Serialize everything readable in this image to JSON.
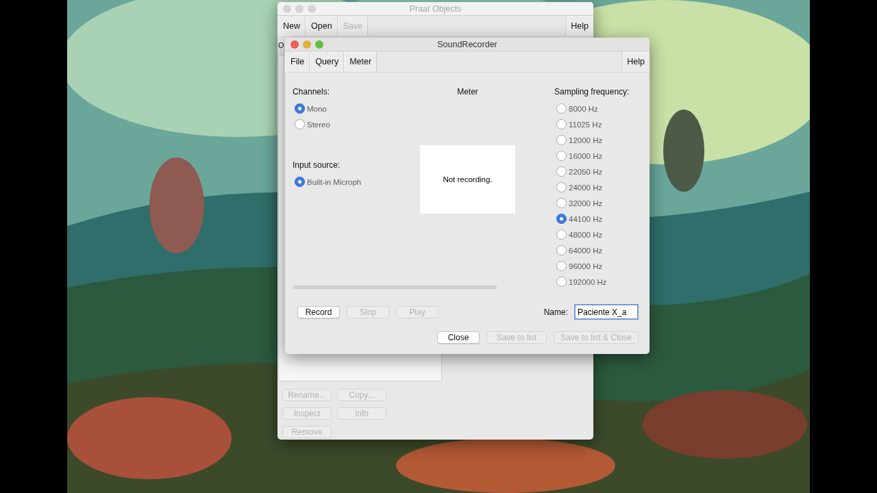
{
  "objects_window": {
    "title": "Praat Objects",
    "menus": [
      {
        "label": "New",
        "disabled": false
      },
      {
        "label": "Open",
        "disabled": false
      },
      {
        "label": "Save",
        "disabled": true
      }
    ],
    "help_menu": "Help",
    "list_label": "O",
    "buttons": [
      {
        "label": "Rename...",
        "disabled": true
      },
      {
        "label": "Copy...",
        "disabled": true
      },
      {
        "label": "Inspect",
        "disabled": true
      },
      {
        "label": "Info",
        "disabled": true
      },
      {
        "label": "Remove",
        "disabled": true
      }
    ]
  },
  "recorder": {
    "title": "SoundRecorder",
    "menus": [
      {
        "label": "File",
        "disabled": false
      },
      {
        "label": "Query",
        "disabled": false
      },
      {
        "label": "Meter",
        "disabled": false
      }
    ],
    "help_menu": "Help",
    "channels": {
      "label": "Channels:",
      "options": [
        {
          "label": "Mono",
          "selected": true
        },
        {
          "label": "Stereo",
          "selected": false
        }
      ]
    },
    "input_source": {
      "label": "Input source:",
      "options": [
        {
          "label": "Built-in Microph",
          "selected": true
        }
      ]
    },
    "meter": {
      "label": "Meter",
      "message": "Not recording."
    },
    "sampling_frequency": {
      "label": "Sampling frequency:",
      "options": [
        {
          "label": "8000 Hz",
          "selected": false
        },
        {
          "label": "11025 Hz",
          "selected": false
        },
        {
          "label": "12000 Hz",
          "selected": false
        },
        {
          "label": "16000 Hz",
          "selected": false
        },
        {
          "label": "22050 Hz",
          "selected": false
        },
        {
          "label": "24000 Hz",
          "selected": false
        },
        {
          "label": "32000 Hz",
          "selected": false
        },
        {
          "label": "44100 Hz",
          "selected": true
        },
        {
          "label": "48000 Hz",
          "selected": false
        },
        {
          "label": "64000 Hz",
          "selected": false
        },
        {
          "label": "96000 Hz",
          "selected": false
        },
        {
          "label": "192000 Hz",
          "selected": false
        }
      ]
    },
    "progress": {
      "level": 0
    },
    "transport_buttons": [
      {
        "label": "Record",
        "disabled": false
      },
      {
        "label": "Stop",
        "disabled": true
      },
      {
        "label": "Play",
        "disabled": true
      }
    ],
    "name_field": {
      "label": "Name:",
      "value": "Paciente X_a",
      "focused": true
    },
    "action_buttons": [
      {
        "label": "Close",
        "disabled": false
      },
      {
        "label": "Save to list",
        "disabled": true
      },
      {
        "label": "Save to list & Close",
        "disabled": true
      }
    ]
  }
}
